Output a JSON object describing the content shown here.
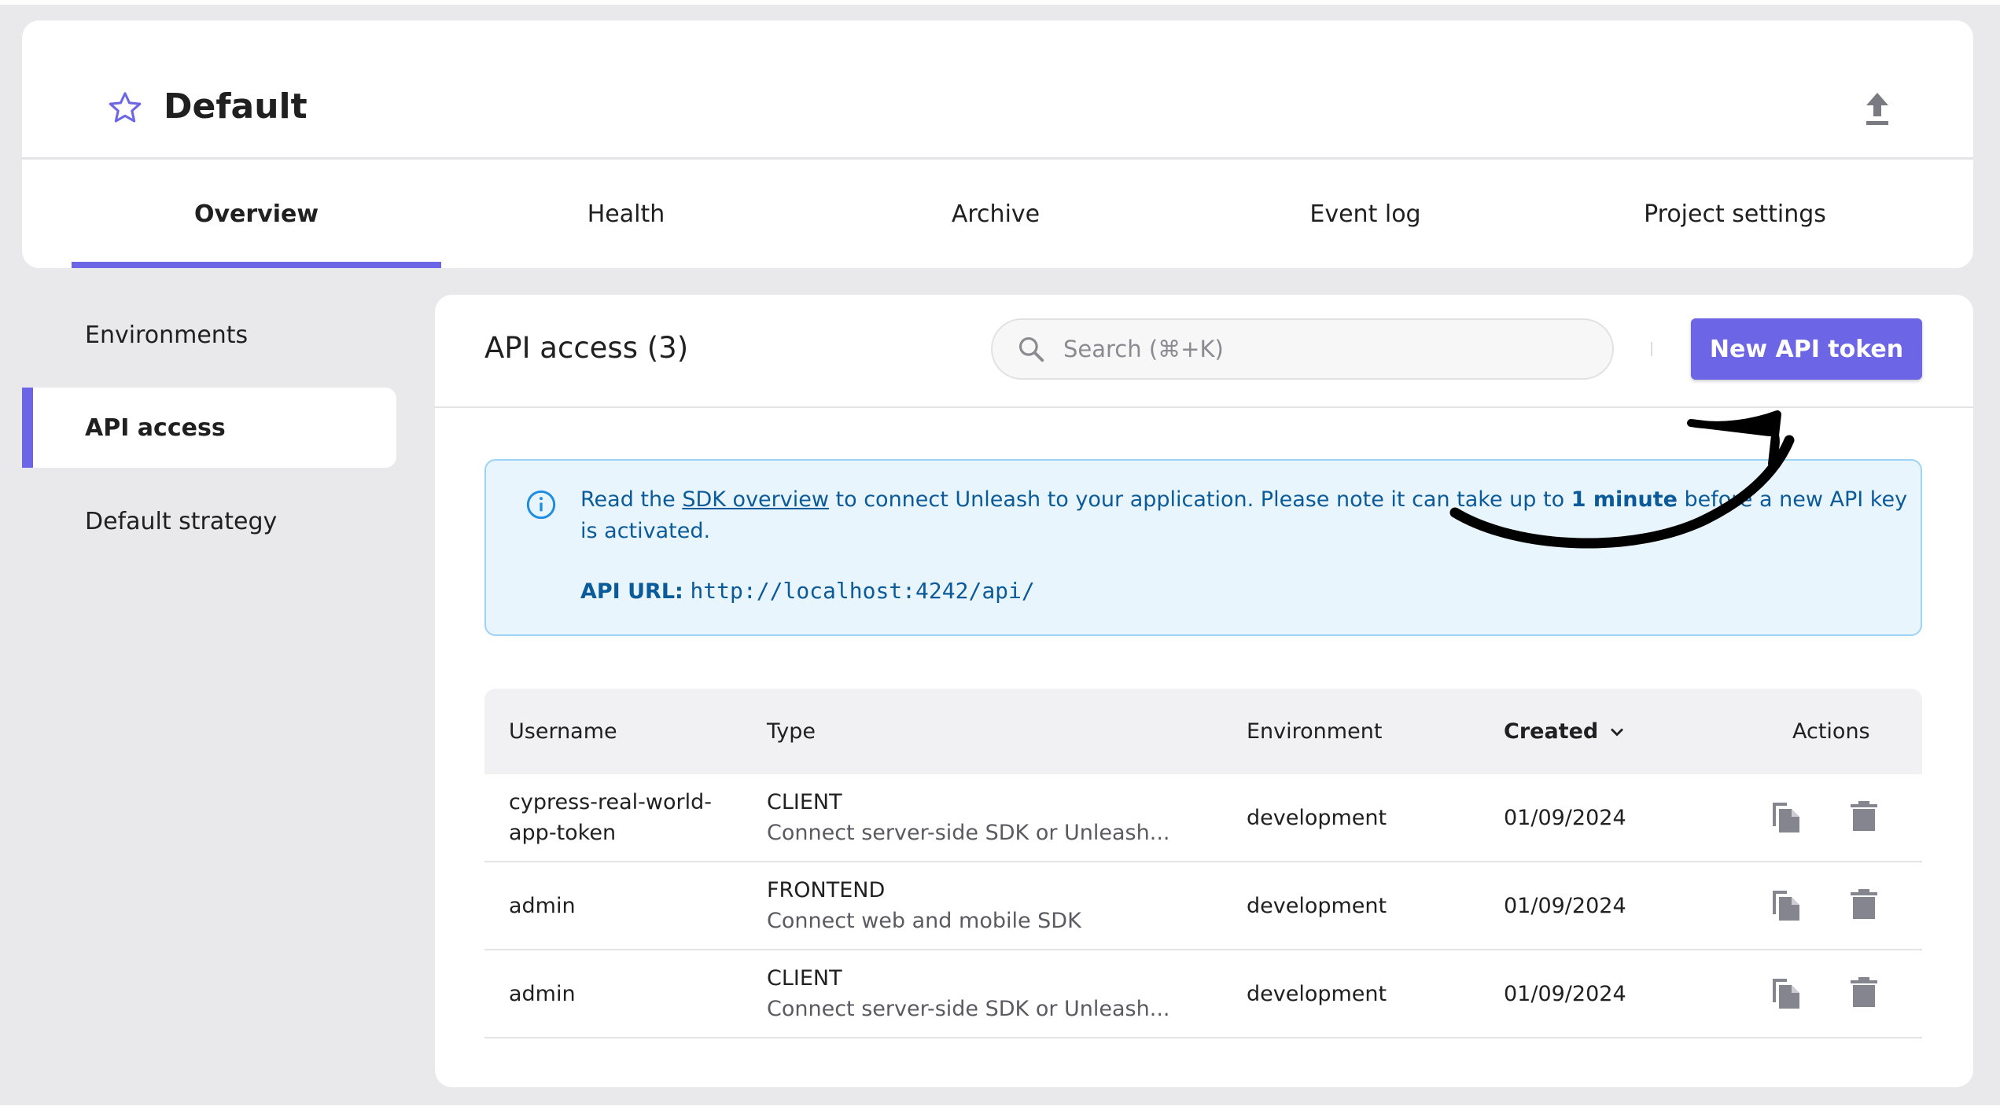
{
  "project": {
    "title": "Default"
  },
  "tabs": [
    {
      "label": "Overview"
    },
    {
      "label": "Health"
    },
    {
      "label": "Archive"
    },
    {
      "label": "Event log"
    },
    {
      "label": "Project settings"
    }
  ],
  "sidebar": {
    "items": [
      {
        "label": "Environments"
      },
      {
        "label": "API access"
      },
      {
        "label": "Default strategy"
      }
    ]
  },
  "main": {
    "title": "API access (3)",
    "search_placeholder": "Search (⌘+K)",
    "new_button": "New API token"
  },
  "info": {
    "t1": "Read the ",
    "link": "SDK overview",
    "t2": " to connect Unleash to your application. Please note it can take up to ",
    "bold": "1 minute",
    "t3": " before a new API key",
    "t4": "is activated.",
    "url_label": "API URL:",
    "url": "http://localhost:4242/api/"
  },
  "table": {
    "headers": {
      "username": "Username",
      "type": "Type",
      "environment": "Environment",
      "created": "Created",
      "actions": "Actions"
    },
    "rows": [
      {
        "username": "cypress-real-world-",
        "username2": "app-token",
        "type": "CLIENT",
        "desc": "Connect server-side SDK or Unleash...",
        "env": "development",
        "created": "01/09/2024"
      },
      {
        "username": "admin",
        "username2": "",
        "type": "FRONTEND",
        "desc": "Connect web and mobile SDK",
        "env": "development",
        "created": "01/09/2024"
      },
      {
        "username": "admin",
        "username2": "",
        "type": "CLIENT",
        "desc": "Connect server-side SDK or Unleash...",
        "env": "development",
        "created": "01/09/2024"
      }
    ]
  },
  "colors": {
    "accent": "#6c65e5",
    "info_bg": "#e9f5fd",
    "info_text": "#0b5a99"
  }
}
